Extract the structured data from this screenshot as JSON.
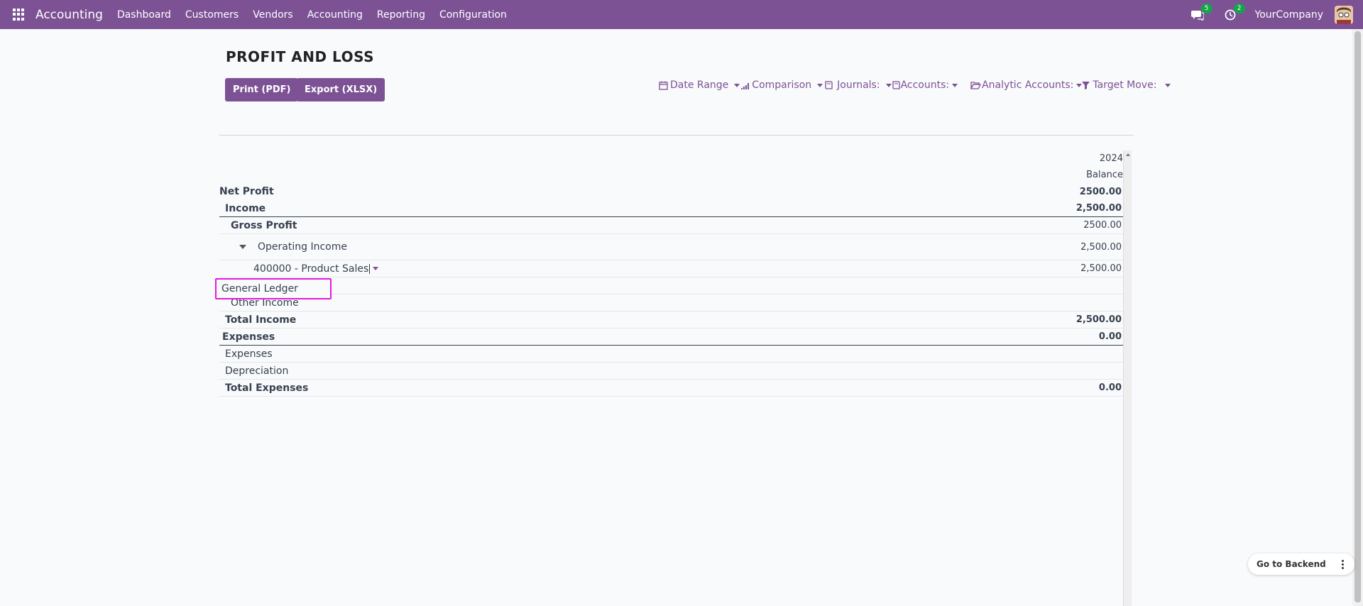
{
  "navbar": {
    "app_name": "Accounting",
    "menu": [
      "Dashboard",
      "Customers",
      "Vendors",
      "Accounting",
      "Reporting",
      "Configuration"
    ],
    "messages_count": "5",
    "activities_count": "2",
    "company": "YourCompany"
  },
  "page": {
    "title": "PROFIT AND LOSS",
    "print_label": "Print (PDF)",
    "export_label": "Export (XLSX)"
  },
  "filters": {
    "date_range": "Date Range",
    "comparison": "Comparison",
    "journals": "Journals:",
    "accounts": "Accounts:",
    "analytic_accounts": "Analytic Accounts:",
    "target_move": "Target Move:"
  },
  "report": {
    "year": "2024",
    "balance_header": "Balance",
    "rows": [
      {
        "name": "Net Profit",
        "value": "2500.00"
      },
      {
        "name": "Income",
        "value": "2,500.00"
      },
      {
        "name": "Gross Profit",
        "value": "2500.00"
      },
      {
        "name": "Operating Income",
        "value": "2,500.00"
      },
      {
        "name": "400000 - Product Sales",
        "value": "2,500.00"
      },
      {
        "name": "Other Income",
        "value": ""
      },
      {
        "name": "Total Income",
        "value": "2,500.00"
      },
      {
        "name": "Expenses",
        "value": "0.00"
      },
      {
        "name": "Expenses",
        "value": ""
      },
      {
        "name": "Depreciation",
        "value": ""
      },
      {
        "name": "Total Expenses",
        "value": "0.00"
      }
    ]
  },
  "context_menu": {
    "general_ledger": "General Ledger"
  },
  "floating": {
    "go_to_backend": "Go to Backend"
  },
  "colors": {
    "brand": "#7c5295",
    "badge": "#16a34a",
    "highlight": "#e11bd9"
  }
}
